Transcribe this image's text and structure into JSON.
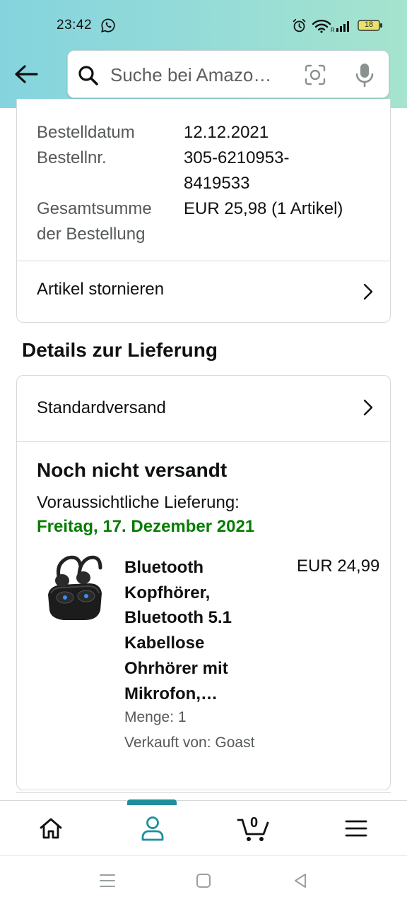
{
  "status_bar": {
    "time": "23:42",
    "battery": "18"
  },
  "search": {
    "placeholder": "Suche bei Amazo…"
  },
  "order": {
    "date_label": "Bestelldatum",
    "date_value": "12.12.2021",
    "number_label": "Bestellnr.",
    "number_value_line1": "305-6210953-",
    "number_value_line2": "8419533",
    "total_label_line1": "Gesamtsumme",
    "total_label_line2": "der Bestellung",
    "total_value": "EUR 25,98 (1 Artikel)",
    "cancel_label": "Artikel stornieren"
  },
  "delivery": {
    "section_title": "Details zur Lieferung",
    "shipping_method": "Standardversand",
    "status": "Noch nicht versandt",
    "expected_label": "Voraussichtliche Lieferung:",
    "expected_date": "Freitag, 17. Dezember 2021",
    "product": {
      "title_lines": [
        "Bluetooth",
        "Kopfhörer,",
        "Bluetooth 5.1",
        "Kabellose",
        "Ohrhörer mit",
        "Mikrofon,…"
      ],
      "price": "EUR 24,99",
      "quantity": "Menge: 1",
      "seller": "Verkauft von: Goast"
    }
  },
  "bottom_nav": {
    "cart_count": "0",
    "active": "account"
  },
  "colors": {
    "accent": "#1d8f9a",
    "delivery_green": "#067d00"
  }
}
